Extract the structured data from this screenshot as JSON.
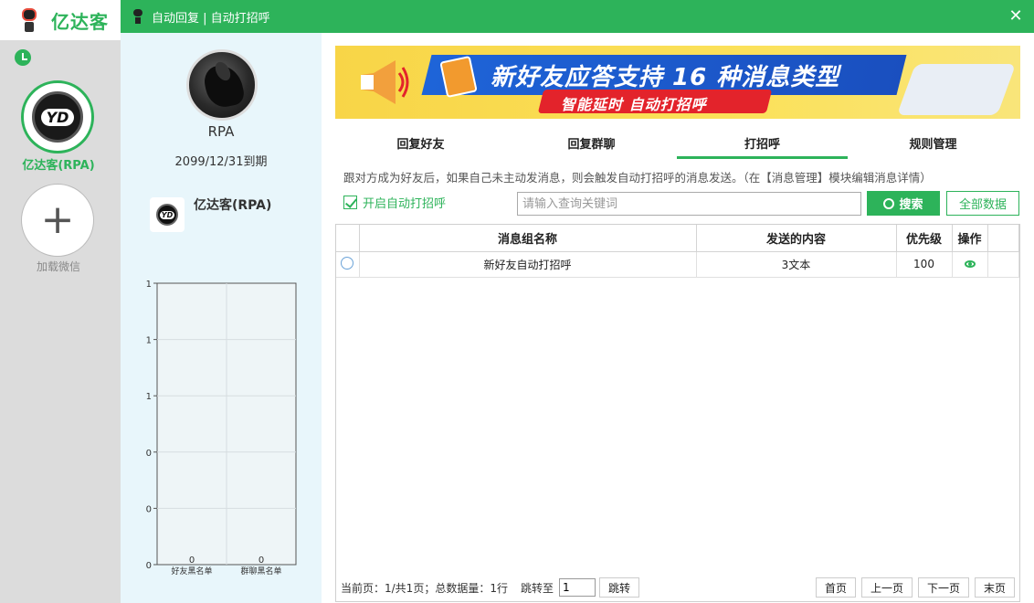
{
  "app": {
    "name": "亿达客",
    "account_label": "亿达客(RPA)",
    "add_label": "加载微信",
    "add_symbol": "+",
    "logo_text": "YD"
  },
  "dialog": {
    "title": "自动回复 | 自动打招呼",
    "close": "✕"
  },
  "profile": {
    "name": "RPA",
    "expire": "2099/12/31到期",
    "account_name": "亿达客(RPA)",
    "logo_text": "YD"
  },
  "chart_data": {
    "type": "bar",
    "categories": [
      "好友黑名单",
      "群聊黑名单"
    ],
    "values": [
      0,
      0
    ],
    "data_labels": [
      "0",
      "0"
    ],
    "y_tick_labels": [
      "1",
      "1",
      "1",
      "0",
      "0",
      "0"
    ],
    "grid": true
  },
  "banner": {
    "main_text": "新好友应答支持 16 种消息类型",
    "sub_text": "智能延时 自动打招呼"
  },
  "tabs": [
    {
      "label": "回复好友",
      "active": false
    },
    {
      "label": "回复群聊",
      "active": false
    },
    {
      "label": "打招呼",
      "active": true
    },
    {
      "label": "规则管理",
      "active": false
    }
  ],
  "desc": "跟对方成为好友后，如果自己未主动发消息，则会触发自动打招呼的消息发送。（在【消息管理】模块编辑消息详情）",
  "toggle_label": "开启自动打招呼",
  "search": {
    "placeholder": "请输入查询关键词",
    "button": "搜索",
    "all_button": "全部数据"
  },
  "table": {
    "headers": [
      "消息组名称",
      "发送的内容",
      "优先级",
      "操作"
    ],
    "rows": [
      {
        "name": "新好友自动打招呼",
        "content": "3文本",
        "priority": "100"
      }
    ]
  },
  "pager": {
    "info": "当前页：1/共1页；总数据量：1行",
    "jump_label": "跳转至",
    "jump_value": "1",
    "go": "跳转",
    "first": "首页",
    "prev": "上一页",
    "next": "下一页",
    "last": "末页"
  },
  "colors": {
    "accent": "#2db35a",
    "banner_blue": "#1e64d8",
    "banner_red": "#e3232b",
    "banner_yellow": "#f8d547"
  }
}
